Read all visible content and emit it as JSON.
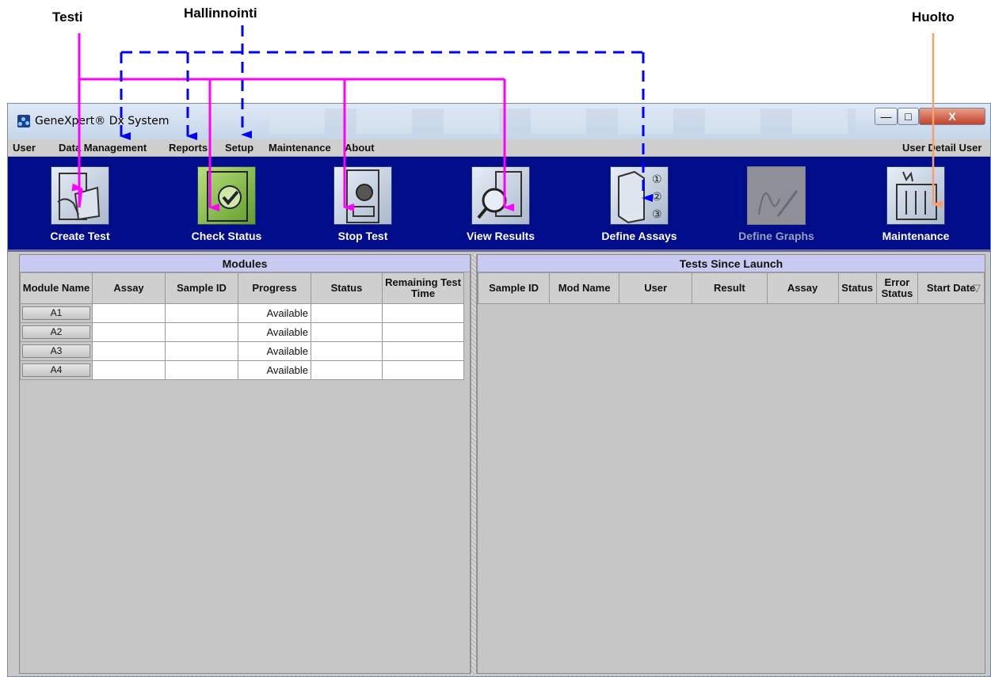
{
  "annotations": {
    "testi": "Testi",
    "hallinnointi": "Hallinnointi",
    "huolto": "Huolto"
  },
  "window": {
    "title": "GeneXpert® Dx System",
    "minimize_glyph": "—",
    "maximize_glyph": "□",
    "close_glyph": "X"
  },
  "menu": {
    "items": [
      "User",
      "Data Management",
      "Reports",
      "Setup",
      "Maintenance",
      "About"
    ],
    "user_detail": "User Detail User"
  },
  "toolbar": {
    "items": [
      {
        "label": "Create Test",
        "icon": "create-test-icon",
        "enabled": true
      },
      {
        "label": "Check Status",
        "icon": "check-status-icon",
        "enabled": true
      },
      {
        "label": "Stop Test",
        "icon": "stop-test-icon",
        "enabled": true
      },
      {
        "label": "View Results",
        "icon": "view-results-icon",
        "enabled": true
      },
      {
        "label": "Define Assays",
        "icon": "define-assays-icon",
        "enabled": true
      },
      {
        "label": "Define Graphs",
        "icon": "define-graphs-icon",
        "enabled": false
      },
      {
        "label": "Maintenance",
        "icon": "maintenance-icon",
        "enabled": true
      }
    ]
  },
  "modules_panel": {
    "title": "Modules",
    "columns": [
      "Module Name",
      "Assay",
      "Sample ID",
      "Progress",
      "Status",
      "Remaining Test Time"
    ],
    "rows": [
      {
        "module": "A1",
        "assay": "",
        "sample_id": "",
        "progress": "Available",
        "status": "",
        "remaining": ""
      },
      {
        "module": "A2",
        "assay": "",
        "sample_id": "",
        "progress": "Available",
        "status": "",
        "remaining": ""
      },
      {
        "module": "A3",
        "assay": "",
        "sample_id": "",
        "progress": "Available",
        "status": "",
        "remaining": ""
      },
      {
        "module": "A4",
        "assay": "",
        "sample_id": "",
        "progress": "Available",
        "status": "",
        "remaining": ""
      }
    ]
  },
  "tests_panel": {
    "title": "Tests Since Launch",
    "columns": [
      "Sample ID",
      "Mod Name",
      "User",
      "Result",
      "Assay",
      "Status",
      "Error Status",
      "Start Date"
    ],
    "sort_glyph": "▽"
  },
  "colors": {
    "toolbar_bg": "#000d8a",
    "panel_header": "#c8caf0",
    "arrow_testi": "#ff00ff",
    "arrow_hallinnointi": "#0000ff",
    "arrow_huolto": "#f5a070"
  }
}
